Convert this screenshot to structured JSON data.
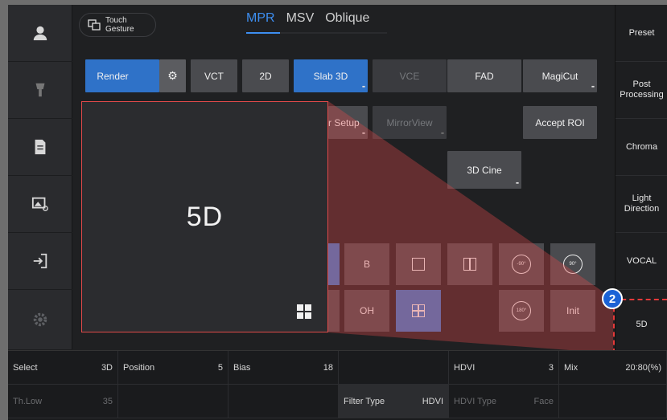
{
  "header": {
    "touch_gesture": [
      "Touch",
      "Gesture"
    ],
    "tabs": [
      {
        "label": "MPR",
        "active": true
      },
      {
        "label": "MSV",
        "active": false
      },
      {
        "label": "Oblique",
        "active": false
      }
    ]
  },
  "left_sidebar": [
    "user-icon",
    "probe-icon",
    "report-icon",
    "review-icon",
    "exit-icon",
    "settings-icon"
  ],
  "right_sidebar": [
    {
      "label": "Preset"
    },
    {
      "label": "Post Processing"
    },
    {
      "label": "Chroma"
    },
    {
      "label": "Light Direction"
    },
    {
      "label": "VOCAL"
    },
    {
      "label": "5D"
    }
  ],
  "mode_buttons": {
    "render": "Render",
    "vct": "VCT",
    "twod": "2D",
    "slab3d": "Slab 3D",
    "vce": "VCE",
    "fad": "FAD",
    "magicut": "MagiCut",
    "setup_partial": "r Setup",
    "mirrorview": "MirrorView",
    "accept_roi": "Accept ROI",
    "cine3d": "3D Cine"
  },
  "tiles": {
    "b": "B",
    "oh": "OH",
    "init": "Init",
    "rot_left": "-90°",
    "rot_right": "90°",
    "rot_180": "180°"
  },
  "zoom": {
    "label": "5D"
  },
  "callout": {
    "number": "2"
  },
  "params": {
    "row1": [
      {
        "k": "Select",
        "v": "3D"
      },
      {
        "k": "Position",
        "v": "5"
      },
      {
        "k": "Bias",
        "v": "18"
      },
      {
        "k": "",
        "v": ""
      },
      {
        "k": "HDVI",
        "v": "3"
      },
      {
        "k": "Mix",
        "v": "20:80(%)"
      }
    ],
    "row2": [
      {
        "k": "Th.Low",
        "v": "35"
      },
      {
        "k": "",
        "v": ""
      },
      {
        "k": "",
        "v": ""
      },
      {
        "k": "Filter Type",
        "v": "HDVI"
      },
      {
        "k": "HDVI Type",
        "v": "Face"
      },
      {
        "k": "",
        "v": ""
      }
    ]
  },
  "colors": {
    "accent": "#3d8ef0",
    "highlight": "#e14a4a",
    "callout": "#1b62d6"
  }
}
